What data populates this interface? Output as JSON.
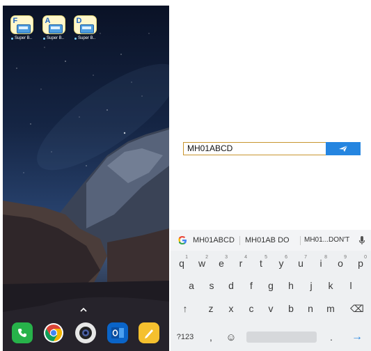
{
  "home_screen": {
    "apps": [
      {
        "letter": "F",
        "label": "Super B.."
      },
      {
        "letter": "A",
        "label": "Super B.."
      },
      {
        "letter": "D",
        "label": "Super B.."
      }
    ],
    "swipe_hint": "^",
    "dock": [
      {
        "icon": "phone-icon",
        "color": "#27b24a"
      },
      {
        "icon": "chrome-icon",
        "color": "#ffffff"
      },
      {
        "icon": "camera-icon",
        "color": "#e7e7e7"
      },
      {
        "icon": "outlook-icon",
        "color": "#0a64c8"
      },
      {
        "icon": "notes-icon",
        "color": "#f5c02e"
      }
    ]
  },
  "chat": {
    "input_value": "MH01ABCD",
    "send_icon": "send-icon",
    "accent": "#2585e0",
    "input_border": "#c8952f"
  },
  "keyboard": {
    "suggestions": [
      "MH01ABCD",
      "MH01AB DO",
      "MH01...DON'T"
    ],
    "rows": [
      [
        {
          "k": "q",
          "n": "1"
        },
        {
          "k": "w",
          "n": "2"
        },
        {
          "k": "e",
          "n": "3"
        },
        {
          "k": "r",
          "n": "4"
        },
        {
          "k": "t",
          "n": "5"
        },
        {
          "k": "y",
          "n": "6"
        },
        {
          "k": "u",
          "n": "7"
        },
        {
          "k": "i",
          "n": "8"
        },
        {
          "k": "o",
          "n": "9"
        },
        {
          "k": "p",
          "n": "0"
        }
      ],
      [
        {
          "k": "a"
        },
        {
          "k": "s"
        },
        {
          "k": "d"
        },
        {
          "k": "f"
        },
        {
          "k": "g"
        },
        {
          "k": "h"
        },
        {
          "k": "j"
        },
        {
          "k": "k"
        },
        {
          "k": "l"
        }
      ],
      [
        {
          "k": "↑"
        },
        {
          "k": "z"
        },
        {
          "k": "x"
        },
        {
          "k": "c"
        },
        {
          "k": "v"
        },
        {
          "k": "b"
        },
        {
          "k": "n"
        },
        {
          "k": "m"
        },
        {
          "k": "⌫"
        }
      ]
    ],
    "bottom_row": {
      "symbols": "?123",
      "comma": ",",
      "emoji": "☺",
      "period": ".",
      "enter": "→"
    }
  }
}
